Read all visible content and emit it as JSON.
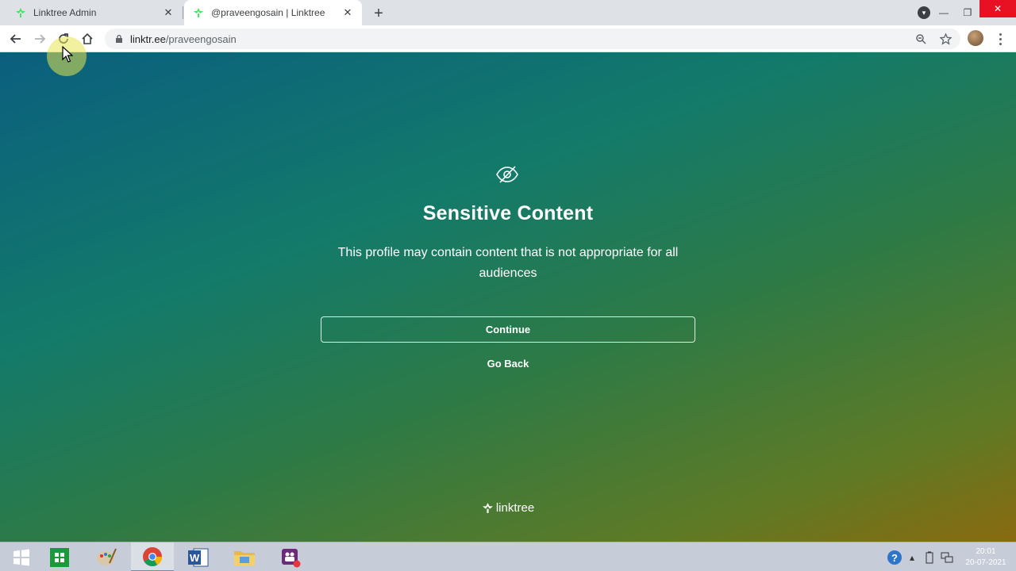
{
  "browser": {
    "tabs": [
      {
        "title": "Linktree Admin",
        "active": false
      },
      {
        "title": "@praveengosain | Linktree",
        "active": true
      }
    ],
    "new_tab_symbol": "+",
    "close_symbol": "✕",
    "url_host": "linktr.ee",
    "url_path": "/praveengosain",
    "window_controls": {
      "minimize": "—",
      "restore": "❐",
      "close": "✕"
    }
  },
  "page": {
    "icon": "eye-slash-icon",
    "title": "Sensitive Content",
    "description": "This profile may contain content that is not appropriate for all audiences",
    "continue_label": "Continue",
    "go_back_label": "Go Back",
    "brand": "linktree"
  },
  "taskbar": {
    "apps": [
      "windows-start-icon",
      "store-icon",
      "paint-icon",
      "chrome-icon",
      "word-icon",
      "file-explorer-icon",
      "teams-icon"
    ],
    "time": "20:01",
    "date": "20-07-2021"
  },
  "colors": {
    "linktree_green": "#43e660",
    "gradient_start": "#0a5f7e",
    "gradient_end": "#8a6a10",
    "close_red": "#e81123"
  }
}
